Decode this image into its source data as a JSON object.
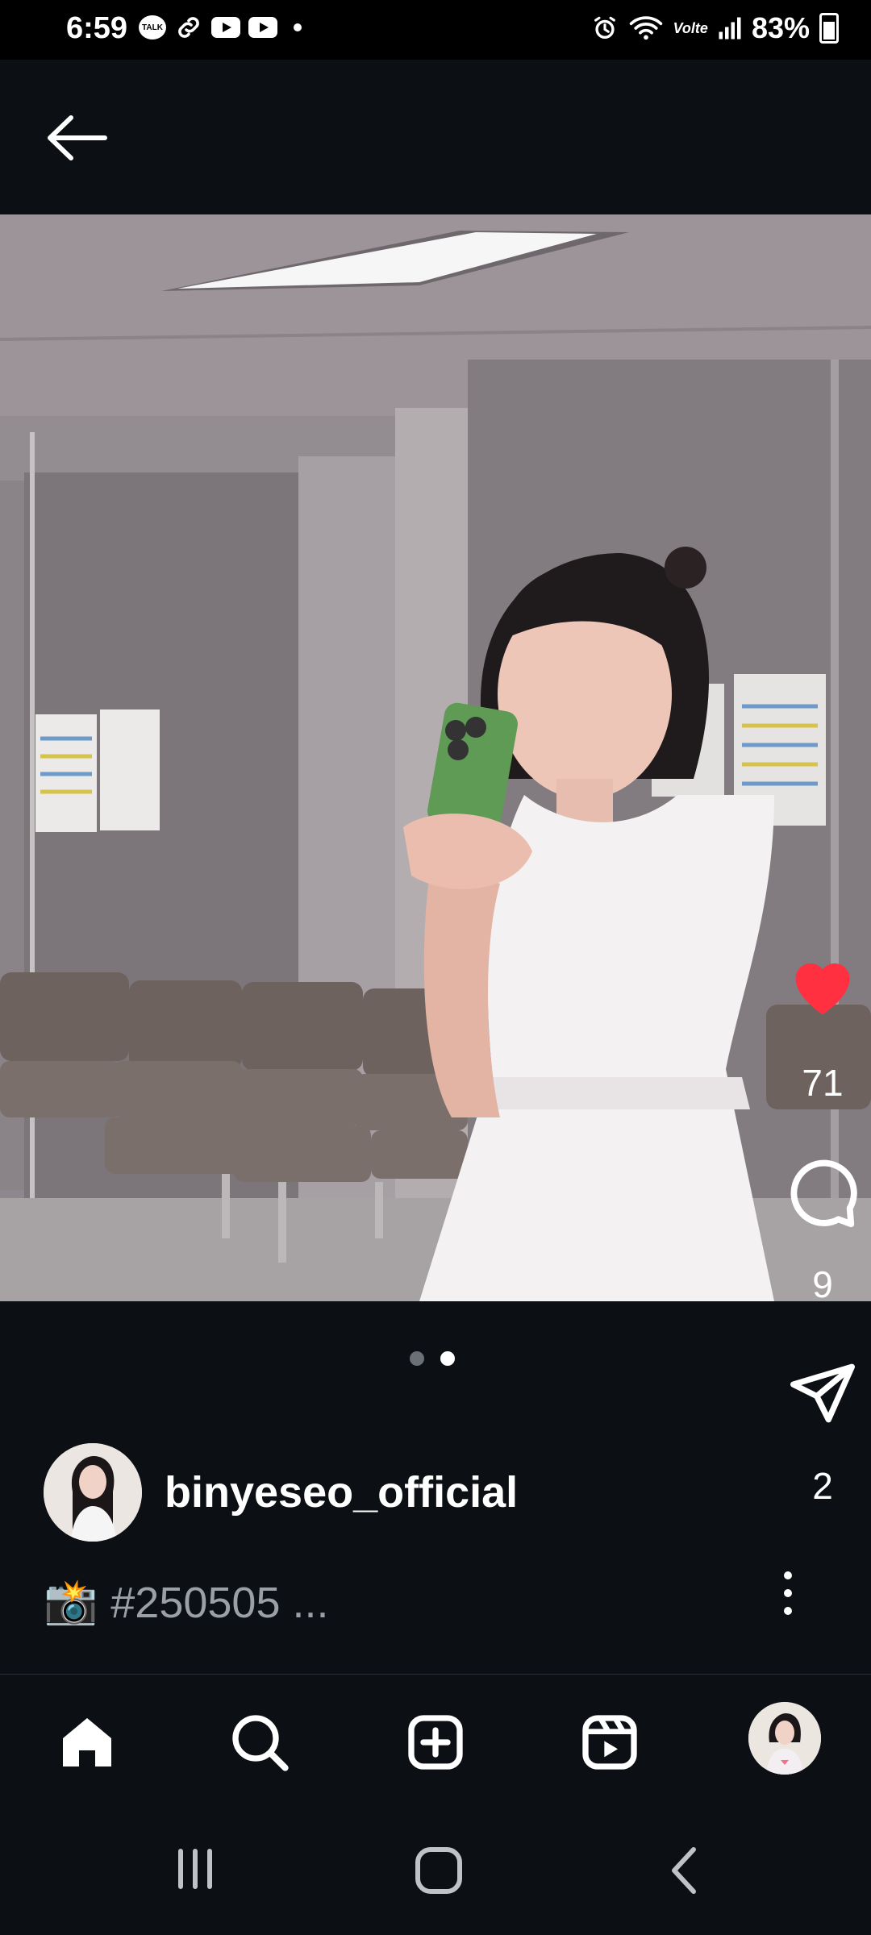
{
  "status_bar": {
    "time": "6:59",
    "talk_label": "TALK",
    "volte": "Volte",
    "battery": "83%"
  },
  "post": {
    "username": "binyeseo_official",
    "caption": "#250505 ...",
    "likes": "71",
    "comments": "9",
    "shares": "2",
    "carousel": {
      "count": 2,
      "active": 2
    }
  },
  "colors": {
    "like": "#ff3040",
    "background": "#0c0f14"
  },
  "icons": {
    "header": "back-arrow-icon",
    "actions": [
      "heart-icon",
      "comment-icon",
      "share-icon",
      "more-icon"
    ],
    "nav": [
      "home-icon",
      "search-icon",
      "create-icon",
      "reels-icon",
      "profile-avatar"
    ],
    "system": [
      "recents-icon",
      "home-button-icon",
      "system-back-icon"
    ]
  }
}
